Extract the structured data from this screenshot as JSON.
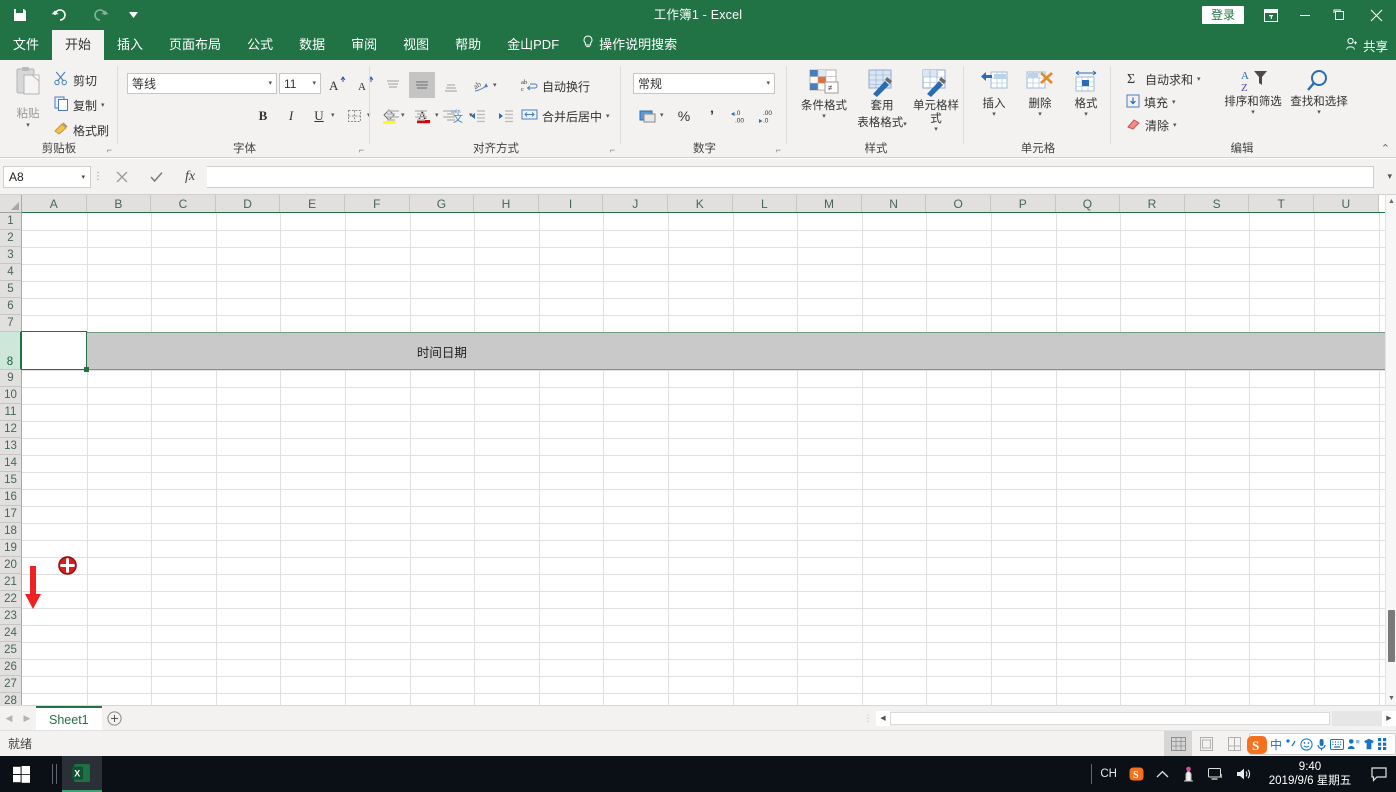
{
  "window": {
    "title": "工作簿1  -  Excel",
    "signin_label": "登录",
    "restore_icon": "restore-down-icon",
    "minimize_icon": "minimize-icon",
    "maximize_icon": "maximize-icon",
    "close_icon": "close-icon",
    "share_label": "共享"
  },
  "quick_access": {
    "save_icon": "save-icon",
    "undo_icon": "undo-icon",
    "redo_icon": "redo-icon",
    "customize_icon": "chevron-down-icon"
  },
  "ribbon_tabs": [
    {
      "label": "文件",
      "active": false
    },
    {
      "label": "开始",
      "active": true
    },
    {
      "label": "插入",
      "active": false
    },
    {
      "label": "页面布局",
      "active": false
    },
    {
      "label": "公式",
      "active": false
    },
    {
      "label": "数据",
      "active": false
    },
    {
      "label": "审阅",
      "active": false
    },
    {
      "label": "视图",
      "active": false
    },
    {
      "label": "帮助",
      "active": false
    },
    {
      "label": "金山PDF",
      "active": false
    }
  ],
  "tell_me": {
    "label": "操作说明搜索",
    "icon": "lightbulb-icon"
  },
  "ribbon": {
    "clipboard": {
      "group_label": "剪贴板",
      "paste_label": "粘贴",
      "cut_label": "剪切",
      "copy_label": "复制",
      "format_painter_label": "格式刷"
    },
    "font": {
      "group_label": "字体",
      "font_name": "等线",
      "font_size": "11",
      "grow_font_label": "A",
      "shrink_font_label": "A",
      "bold_label": "B",
      "italic_label": "I",
      "underline_label": "U",
      "borders_icon": "borders-icon",
      "fill_color_icon": "fill-color-icon",
      "font_color_icon": "font-color-icon",
      "phonetic_icon": "phonetic-guide-icon"
    },
    "alignment": {
      "group_label": "对齐方式",
      "wrap_text_label": "自动换行",
      "merge_center_label": "合并后居中",
      "orientation_icon": "text-orientation-icon",
      "decrease_indent_icon": "decrease-indent-icon",
      "increase_indent_icon": "increase-indent-icon"
    },
    "number": {
      "group_label": "数字",
      "format_value": "常规",
      "accounting_icon": "accounting-format-icon",
      "percent_label": "%",
      "comma_label": "'",
      "increase_decimal_label": "增加小数位数",
      "decrease_decimal_label": "减少小数位数"
    },
    "styles": {
      "group_label": "样式",
      "conditional_label": "条件格式",
      "table_label_1": "套用",
      "table_label_2": "表格格式",
      "cell_styles_label": "单元格样式"
    },
    "cells": {
      "group_label": "单元格",
      "insert_label": "插入",
      "delete_label": "删除",
      "format_label": "格式"
    },
    "editing": {
      "group_label": "编辑",
      "autosum_label": "自动求和",
      "fill_label": "填充",
      "clear_label": "清除",
      "sort_filter_label": "排序和筛选",
      "find_select_label": "查找和选择"
    },
    "collapse_icon": "chevron-up-icon"
  },
  "formula_bar": {
    "name_box_value": "A8",
    "cancel_icon": "cancel-icon",
    "enter_icon": "check-icon",
    "function_icon": "fx-icon",
    "formula_value": "",
    "expand_icon": "chevron-down-icon"
  },
  "grid": {
    "columns": [
      "A",
      "B",
      "C",
      "D",
      "E",
      "F",
      "G",
      "H",
      "I",
      "J",
      "K",
      "L",
      "M",
      "N",
      "O",
      "P",
      "Q",
      "R",
      "S",
      "T",
      "U"
    ],
    "rows": [
      1,
      2,
      3,
      4,
      5,
      6,
      7,
      8,
      9,
      10,
      11,
      12,
      13,
      14,
      15,
      16,
      17,
      18,
      19,
      20,
      21,
      22,
      23,
      24,
      25,
      26,
      27,
      28
    ],
    "selected_row": 8,
    "active_cell": "A8",
    "cell_values": [
      {
        "cell": "G8",
        "text": "时间日期"
      }
    ],
    "annotations": {
      "arrow_icon": "red-down-arrow-annotation",
      "cursor_icon": "red-crosshair-cursor",
      "arrow_color": "#ee2222",
      "cursor_color": "#d42020"
    }
  },
  "sheet_bar": {
    "prev_icon": "prev-sheet-icon",
    "next_icon": "next-sheet-icon",
    "tabs": [
      {
        "name": "Sheet1",
        "active": true
      }
    ],
    "add_sheet_icon": "add-sheet-icon"
  },
  "status_bar": {
    "status_text": "就绪",
    "view_normal_icon": "normal-view-icon",
    "view_page_layout_icon": "page-layout-view-icon",
    "view_page_break_icon": "page-break-view-icon"
  },
  "ime_bar": {
    "logo": "sogou-logo-icon",
    "mode_label": "中",
    "punct_icon": "punctuation-icon",
    "emoji_icon": "emoji-icon",
    "mic_icon": "microphone-icon",
    "keyboard_icon": "soft-keyboard-icon",
    "user_icon": "user-icon",
    "skin_icon": "skin-icon",
    "menu_icon": "menu-icon"
  },
  "taskbar": {
    "start_icon": "windows-start-icon",
    "excel_icon": "excel-taskbar-icon",
    "lang_label": "CH",
    "sogou_tray_icon": "sogou-tray-icon",
    "show_hidden_icon": "show-hidden-icons-chevron",
    "app_tray_icon": "tray-app-icon",
    "network_icon": "network-icon",
    "volume_icon": "volume-icon",
    "time": "9:40",
    "date": "2019/9/6 星期五",
    "action_center_icon": "action-center-icon"
  },
  "colors": {
    "excel_green": "#217346",
    "ribbon_bg": "#f3f2f1",
    "selection_gray": "#c9c9c9",
    "annotation_red": "#ee2222"
  }
}
